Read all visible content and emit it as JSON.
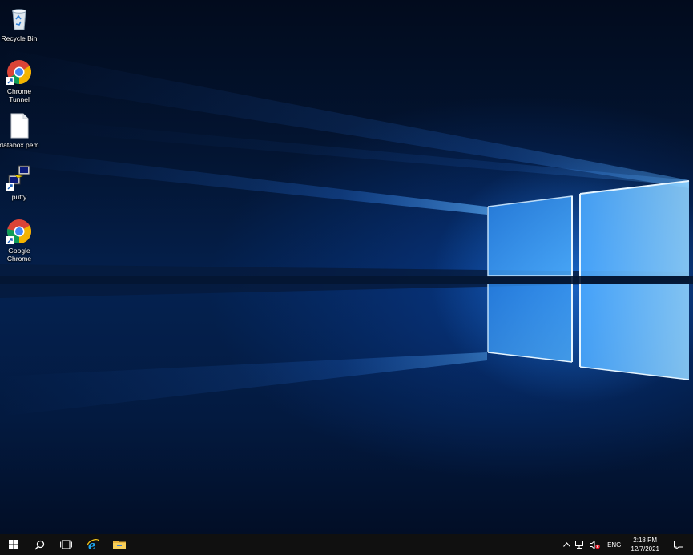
{
  "desktop": {
    "icons": [
      {
        "label": "Recycle Bin",
        "icon": "recycle-bin-icon"
      },
      {
        "label": "Chrome Tunnel",
        "icon": "chrome-icon"
      },
      {
        "label": "databox.pem",
        "icon": "file-icon"
      },
      {
        "label": "putty",
        "icon": "putty-icon"
      },
      {
        "label": "Google Chrome",
        "icon": "chrome-icon"
      }
    ]
  },
  "taskbar": {
    "pinned": [
      {
        "name": "start",
        "icon": "windows-logo-icon"
      },
      {
        "name": "search",
        "icon": "search-icon"
      },
      {
        "name": "task-view",
        "icon": "task-view-icon"
      },
      {
        "name": "internet-explorer",
        "icon": "internet-explorer-icon"
      },
      {
        "name": "file-explorer",
        "icon": "folder-icon"
      }
    ],
    "tray": {
      "language": "ENG",
      "time": "2:18 PM",
      "date": "12/7/2021"
    }
  },
  "colors": {
    "taskbar_bg": "#101010",
    "wallpaper_glow": "#2a8cff",
    "wallpaper_dark": "#031533"
  }
}
